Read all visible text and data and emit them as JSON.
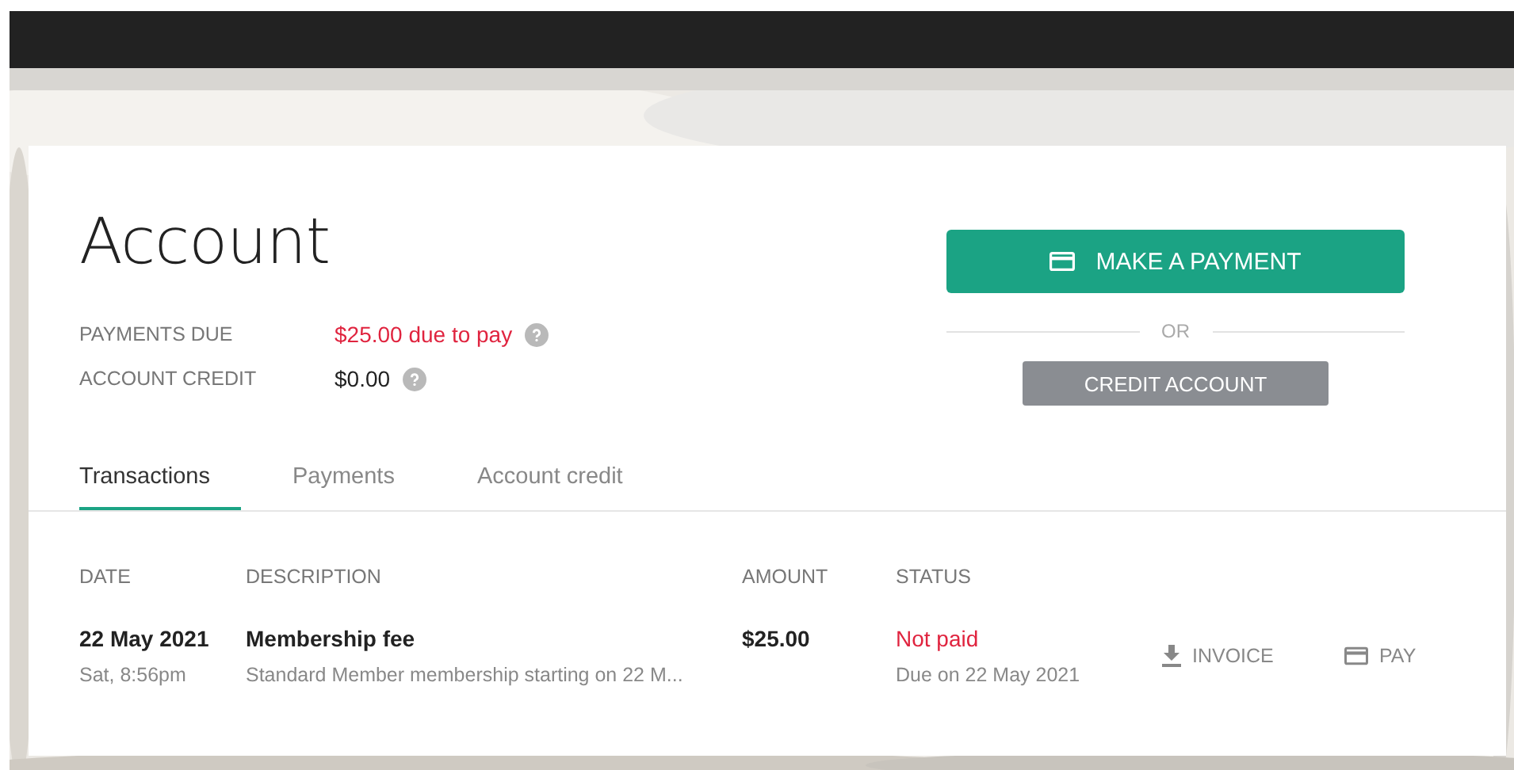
{
  "page": {
    "title": "Account"
  },
  "summary": [
    {
      "label": "PAYMENTS DUE",
      "value": "$25.00 due to pay",
      "alert": true,
      "help": true
    },
    {
      "label": "ACCOUNT CREDIT",
      "value": "$0.00",
      "alert": false,
      "help": true
    }
  ],
  "actions": {
    "primary": "MAKE A PAYMENT",
    "separator": "OR",
    "secondary": "CREDIT ACCOUNT"
  },
  "tabs": [
    {
      "label": "Transactions",
      "selected": true
    },
    {
      "label": "Payments",
      "selected": false
    },
    {
      "label": "Account credit",
      "selected": false
    }
  ],
  "table": {
    "columns": [
      "DATE",
      "DESCRIPTION",
      "AMOUNT",
      "STATUS"
    ],
    "rows": [
      {
        "date": "22 May 2021",
        "time": "Sat, 8:56pm",
        "description": "Membership fee",
        "detail": "Standard Member membership starting on 22 M...",
        "amount": "$25.00",
        "status": "Not paid",
        "paid": false,
        "due": "Due on 22 May 2021",
        "actions": [
          {
            "kind": "download",
            "label": "INVOICE"
          },
          {
            "kind": "card",
            "label": "PAY"
          }
        ]
      }
    ]
  }
}
